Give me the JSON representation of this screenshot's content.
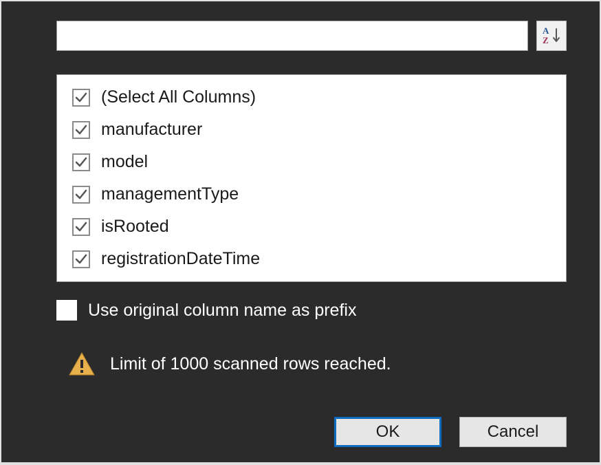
{
  "search": {
    "value": "",
    "placeholder": ""
  },
  "sort_icon": "sort-az-icon",
  "columns": [
    {
      "label": "(Select All Columns)",
      "checked": true
    },
    {
      "label": "manufacturer",
      "checked": true
    },
    {
      "label": "model",
      "checked": true
    },
    {
      "label": "managementType",
      "checked": true
    },
    {
      "label": "isRooted",
      "checked": true
    },
    {
      "label": "registrationDateTime",
      "checked": true
    }
  ],
  "prefix": {
    "label": "Use original column name as prefix",
    "checked": false
  },
  "warning": {
    "text": "Limit of 1000 scanned rows reached."
  },
  "buttons": {
    "ok": "OK",
    "cancel": "Cancel"
  },
  "colors": {
    "accent": "#0f6cbd",
    "warning_fill": "#e8b04c",
    "sort_a": "#2a5796",
    "sort_z": "#9b3058"
  }
}
